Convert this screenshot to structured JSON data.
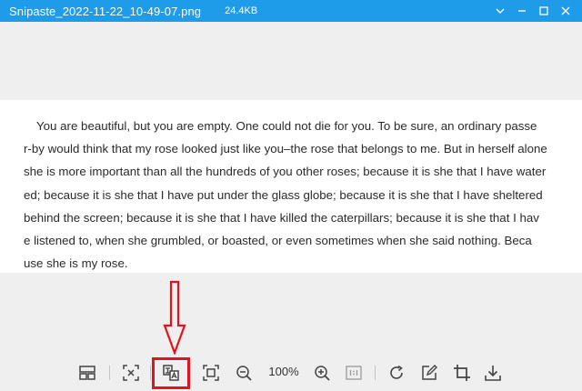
{
  "window": {
    "title": "Snipaste_2022-11-22_10-49-07.png",
    "file_size": "24.4KB",
    "controls": [
      "pin-icon",
      "minimize-icon",
      "maximize-icon",
      "close-icon"
    ],
    "titlebar_color": "#1e9be9"
  },
  "document": {
    "lines": [
      "You are beautiful,  but you are empty. One could not die for you. To be sure,  an ordinary passe",
      "r-by would think that my rose looked just like you–the rose that belongs to me. But in herself alone",
      "she is more important than all the hundreds of you other roses;  because it is she that I have water",
      "ed;  because it is she that I have put under the glass globe;  because it is she that I have sheltered",
      "behind the screen;  because it is she that I have killed the caterpillars;  because it is she that I hav",
      "e listened to,  when she grumbled,  or boasted,  or even sometimes when she said nothing. Beca",
      "use she is my rose."
    ]
  },
  "annotation": {
    "color": "#e0141e",
    "arrow_target": "translate-button"
  },
  "toolbar": {
    "zoom": "100%",
    "icons": [
      "layout-icon",
      "fit-icon",
      "translate-icon",
      "fullscreen-icon",
      "zoom-out-icon",
      "zoom-in-icon",
      "actual-size-icon",
      "rotate-icon",
      "edit-icon",
      "crop-icon",
      "download-icon"
    ]
  }
}
